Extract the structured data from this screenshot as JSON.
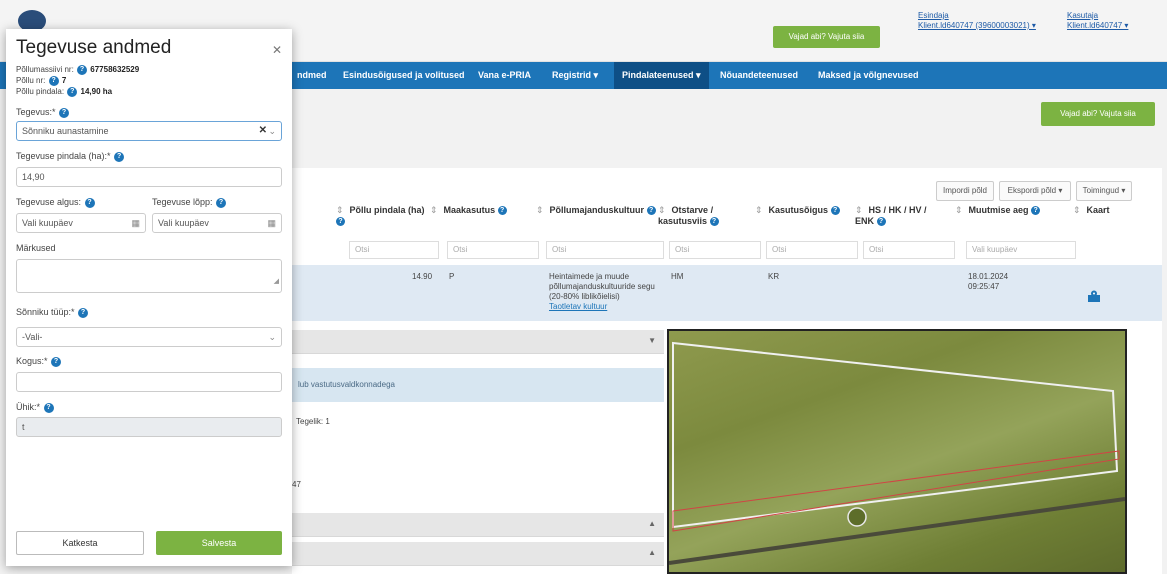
{
  "topbar": {
    "help_label": "Vajad abi? Vajuta siia",
    "role1": "Esindaja",
    "user1": "Klient.ld640747 (39600003021) ▾",
    "role2": "Kasutaja",
    "user2": "Klient.ld640747 ▾"
  },
  "nav": {
    "items": [
      "ndmed",
      "Esindusõigused ja volitused",
      "Vana e-PRIA",
      "Registrid ▾",
      "Pindalateenused ▾",
      "Nõuandeteenused",
      "Maksed ja võlgnevused"
    ]
  },
  "page": {
    "help_label": "Vajad abi? Vajuta siia",
    "import_label": "Impordi põld",
    "export_label": "Ekspordi põld ▾",
    "actions_label": "Toimingud ▾"
  },
  "table": {
    "headers": [
      "Põllu pindala (ha)",
      "Maakasutus",
      "Põllumajanduskultuur",
      "Otstarve / kasutusviis",
      "Kasutusõigus",
      "HS / HK / HV / ENK",
      "Muutmise aeg",
      "Kaart"
    ],
    "filter_placeholder": "Otsi",
    "date_placeholder": "Vali kuupäev",
    "row": {
      "area": "14.90",
      "land_use": "P",
      "crop_line1": "Heintaimede ja muude",
      "crop_line2": "põllumajanduskultuuride segu",
      "crop_line3": "(20-80% liblikõielisi)",
      "crop_link": "Taotletav kultuur",
      "purpose": "HM",
      "right": "KR",
      "modified_date": "18.01.2024",
      "modified_time": "09:25:47"
    }
  },
  "panel": {
    "info_text": "lub vastutusvaldkonnadega",
    "step_text": "Tegelik: 1",
    "partial": "47"
  },
  "modal": {
    "title": "Tegevuse andmed",
    "farm_label": "Põllumassiivi nr:",
    "farm_value": "67758632529",
    "field_no_label": "Põllu nr:",
    "field_no_value": "7",
    "field_area_label": "Põllu pindala:",
    "field_area_value": "14,90 ha",
    "activity_label": "Tegevus:*",
    "activity_value": "Sõnniku aunastamine",
    "activity_area_label": "Tegevuse pindala (ha):*",
    "activity_area_value": "14,90",
    "start_label": "Tegevuse algus:",
    "end_label": "Tegevuse lõpp:",
    "date_placeholder": "Vali kuupäev",
    "notes_label": "Märkused",
    "manure_type_label": "Sõnniku tüüp:*",
    "manure_type_value": "-Vali-",
    "amount_label": "Kogus:*",
    "unit_label": "Ühik:*",
    "unit_value": "t",
    "cancel_label": "Katkesta",
    "save_label": "Salvesta"
  }
}
